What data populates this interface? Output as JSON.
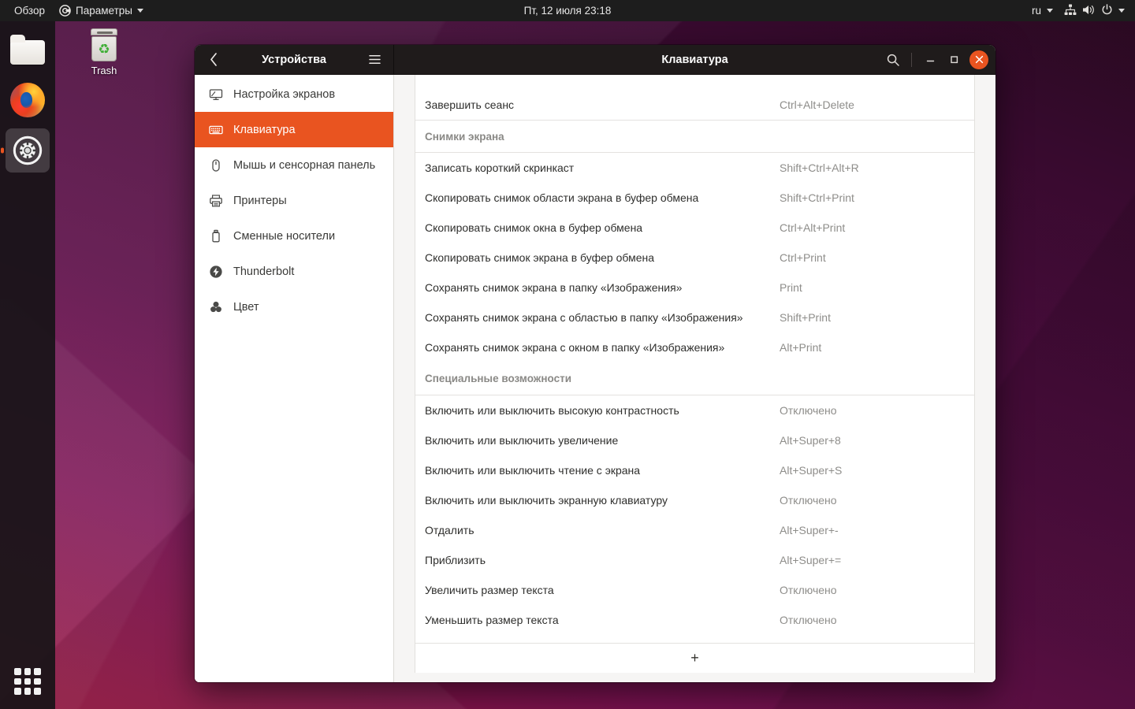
{
  "top_panel": {
    "activities_label": "Обзор",
    "app_menu_label": "Параметры",
    "clock": "Пт, 12 июля  23:18",
    "keyboard_layout": "ru",
    "icons": [
      "settings-app-icon",
      "caret-down-icon",
      "network-icon",
      "volume-icon",
      "power-icon",
      "caret-down-icon"
    ]
  },
  "dock": {
    "items": [
      {
        "name": "files",
        "icon": "files-icon",
        "active": false
      },
      {
        "name": "firefox",
        "icon": "firefox-icon",
        "active": false
      },
      {
        "name": "settings",
        "icon": "settings-gear-icon",
        "active": true
      }
    ],
    "show_apps_label": "show-applications-grid-icon"
  },
  "desktop": {
    "trash_label": "Trash"
  },
  "window": {
    "sidebar_title": "Устройства",
    "content_title": "Клавиатура",
    "back_icon": "chevron-left-icon",
    "menu_icon": "hamburger-menu-icon",
    "search_icon": "search-icon",
    "minimize_icon": "minimize-icon",
    "maximize_icon": "maximize-icon",
    "close_icon": "close-icon",
    "accent_color": "#e95420",
    "titlebar_color": "#1f1b1b"
  },
  "sidebar": {
    "items": [
      {
        "label": "Настройка экранов",
        "icon": "display-icon",
        "selected": false
      },
      {
        "label": "Клавиатура",
        "icon": "keyboard-icon",
        "selected": true
      },
      {
        "label": "Мышь и сенсорная панель",
        "icon": "mouse-icon",
        "selected": false
      },
      {
        "label": "Принтеры",
        "icon": "printer-icon",
        "selected": false
      },
      {
        "label": "Сменные носители",
        "icon": "removable-media-icon",
        "selected": false
      },
      {
        "label": "Thunderbolt",
        "icon": "thunderbolt-icon",
        "selected": false
      },
      {
        "label": "Цвет",
        "icon": "color-icon",
        "selected": false
      }
    ]
  },
  "shortcuts": {
    "clipped_top_row": {
      "name": "",
      "accel": ""
    },
    "rows": [
      {
        "type": "row",
        "name": "Завершить сеанс",
        "accel": "Ctrl+Alt+Delete"
      },
      {
        "type": "section",
        "name": "Снимки экрана"
      },
      {
        "type": "row",
        "name": "Записать короткий скринкаст",
        "accel": "Shift+Ctrl+Alt+R"
      },
      {
        "type": "row",
        "name": "Скопировать снимок области экрана в буфер обмена",
        "accel": "Shift+Ctrl+Print"
      },
      {
        "type": "row",
        "name": "Скопировать снимок окна в буфер обмена",
        "accel": "Ctrl+Alt+Print"
      },
      {
        "type": "row",
        "name": "Скопировать снимок экрана в буфер обмена",
        "accel": "Ctrl+Print"
      },
      {
        "type": "row",
        "name": "Сохранять снимок экрана в папку «Изображения»",
        "accel": "Print"
      },
      {
        "type": "row",
        "name": "Сохранять снимок экрана с областью в папку «Изображения»",
        "accel": "Shift+Print"
      },
      {
        "type": "row",
        "name": "Сохранять снимок экрана с окном в папку «Изображения»",
        "accel": "Alt+Print"
      },
      {
        "type": "section",
        "name": "Специальные возможности"
      },
      {
        "type": "row",
        "name": "Включить или выключить высокую контрастность",
        "accel": "Отключено"
      },
      {
        "type": "row",
        "name": "Включить или выключить увеличение",
        "accel": "Alt+Super+8"
      },
      {
        "type": "row",
        "name": "Включить или выключить чтение с экрана",
        "accel": "Alt+Super+S"
      },
      {
        "type": "row",
        "name": "Включить или выключить экранную клавиатуру",
        "accel": "Отключено"
      },
      {
        "type": "row",
        "name": "Отдалить",
        "accel": "Alt+Super+-"
      },
      {
        "type": "row",
        "name": "Приблизить",
        "accel": "Alt+Super+="
      },
      {
        "type": "row",
        "name": "Увеличить размер текста",
        "accel": "Отключено"
      },
      {
        "type": "row",
        "name": "Уменьшить размер текста",
        "accel": "Отключено"
      }
    ],
    "add_button_label": "+"
  }
}
